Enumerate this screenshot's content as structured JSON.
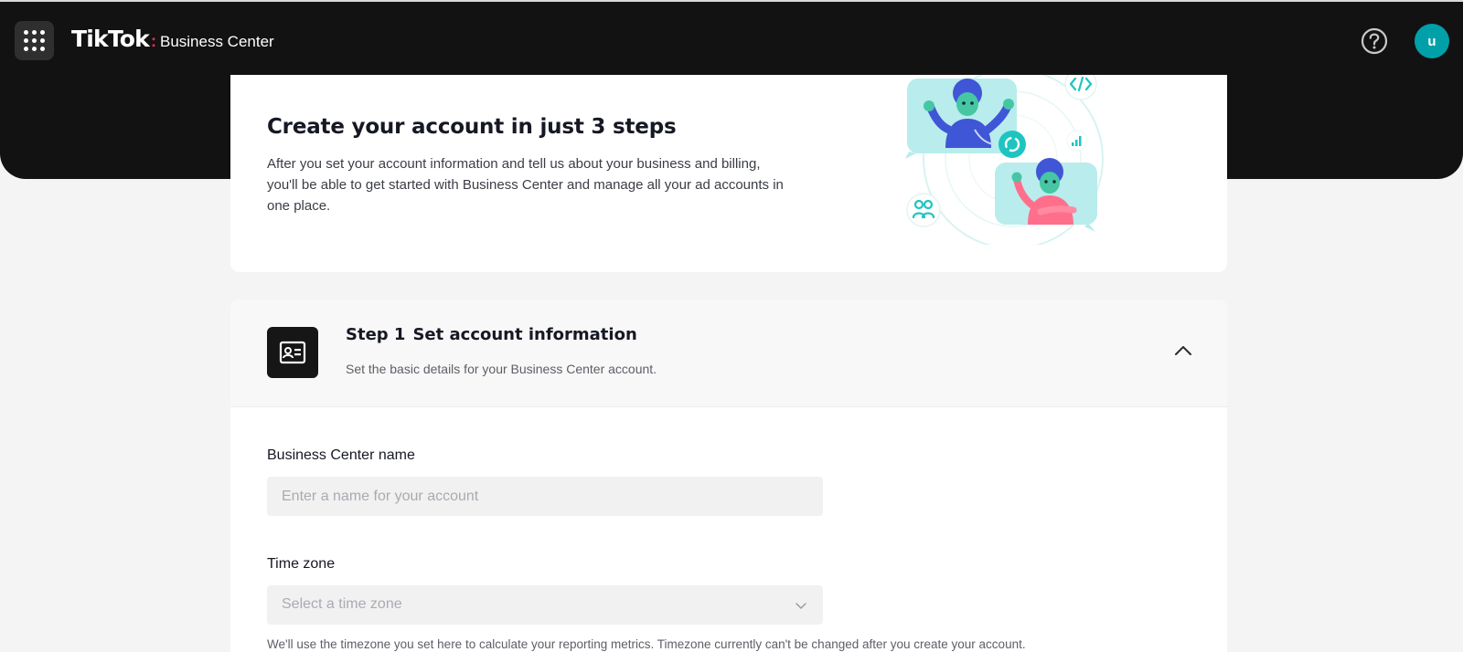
{
  "header": {
    "logo_wordmark": "TikTok",
    "logo_separator": ":",
    "logo_product": "Business Center",
    "avatar_initial": "u"
  },
  "intro": {
    "title": "Create your account in just 3 steps",
    "description": "After you set your account information and tell us about your business and billing, you'll be able to get started with Business Center and manage all your ad accounts in one place."
  },
  "step1": {
    "step_label": "Step 1",
    "title": "Set account information",
    "subtitle": "Set the basic details for your Business Center account.",
    "fields": {
      "name_label": "Business Center name",
      "name_placeholder": "Enter a name for your account",
      "name_value": "",
      "timezone_label": "Time zone",
      "timezone_placeholder": "Select a time zone",
      "timezone_hint": "We'll use the timezone you set here to calculate your reporting metrics. Timezone currently can't be changed after you create your account."
    }
  },
  "colors": {
    "topbar_bg": "#121212",
    "page_bg": "#f4f4f4",
    "avatar_bg": "#00a0a8",
    "logo_accent": "#fe2c55",
    "accent_teal": "#1ec5c0"
  },
  "icons": {
    "apps": "grid-dots-icon",
    "help": "question-circle-icon",
    "step1": "id-card-icon",
    "collapse": "chevron-up-icon",
    "select": "chevron-down-icon"
  }
}
